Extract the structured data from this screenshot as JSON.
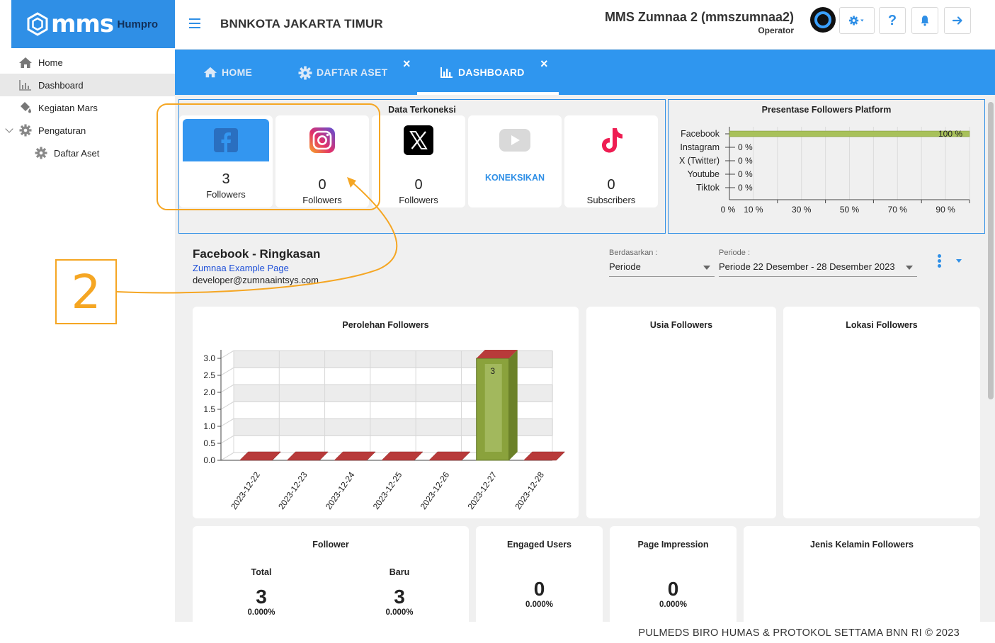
{
  "brand": {
    "logo_text": "mms",
    "app_name": "Humpro"
  },
  "header": {
    "org_title": "BNNKOTA JAKARTA TIMUR",
    "user_name": "MMS Zumnaa 2 (mmszumnaa2)",
    "user_role": "Operator",
    "help_label": "?"
  },
  "sidebar": {
    "items": [
      {
        "label": "Home",
        "icon": "home-icon"
      },
      {
        "label": "Dashboard",
        "icon": "chart-icon"
      },
      {
        "label": "Kegiatan Mars",
        "icon": "paint-bucket-icon"
      },
      {
        "label": "Pengaturan",
        "icon": "gear-icon"
      },
      {
        "label": "Daftar Aset",
        "icon": "gear-icon"
      }
    ],
    "active": "Dashboard"
  },
  "tabs": [
    {
      "label": "HOME",
      "icon": "home-icon",
      "closable": false
    },
    {
      "label": "DAFTAR ASET",
      "icon": "gear-icon",
      "closable": true
    },
    {
      "label": "DASHBOARD",
      "icon": "chart-icon",
      "closable": true,
      "active": true
    }
  ],
  "tab_close_glyph": "×",
  "connected": {
    "title": "Data Terkoneksi",
    "cards": [
      {
        "platform": "Facebook",
        "value": "3",
        "label": "Followers"
      },
      {
        "platform": "Instagram",
        "value": "0",
        "label": "Followers"
      },
      {
        "platform": "X",
        "value": "0",
        "label": "Followers"
      },
      {
        "platform": "Youtube",
        "action": "KONEKSIKAN"
      },
      {
        "platform": "Tiktok",
        "value": "0",
        "label": "Subscribers"
      }
    ]
  },
  "platform_percent": {
    "title": "Presentase Followers Platform",
    "rows": [
      {
        "name": "Facebook",
        "value": 100,
        "label": "100 %"
      },
      {
        "name": "Instagram",
        "value": 0,
        "label": "0 %"
      },
      {
        "name": "X (Twitter)",
        "value": 0,
        "label": "0 %"
      },
      {
        "name": "Youtube",
        "value": 0,
        "label": "0 %"
      },
      {
        "name": "Tiktok",
        "value": 0,
        "label": "0 %"
      }
    ],
    "ticks": [
      "0 %",
      "10 %",
      "30 %",
      "50 %",
      "70 %",
      "90 %"
    ],
    "tick_values": [
      0,
      10,
      30,
      50,
      70,
      90
    ],
    "bar_color": "#a8c15a"
  },
  "summary": {
    "title": "Facebook - Ringkasan",
    "page_link": "Zumnaa Example Page",
    "email": "developer@zumnaaintsys.com"
  },
  "filters": {
    "basis_label": "Berdasarkan :",
    "basis_value": "Periode",
    "period_label": "Periode :",
    "period_value": "Periode 22 Desember - 28 Desember 2023"
  },
  "widgets": {
    "gain_title": "Perolehan Followers",
    "age_title": "Usia Followers",
    "location_title": "Lokasi Followers",
    "follower_title": "Follower",
    "follower_total_label": "Total",
    "follower_total_value": "3",
    "follower_total_pct": "0.000%",
    "follower_new_label": "Baru",
    "follower_new_value": "3",
    "follower_new_pct": "0.000%",
    "engaged_title": "Engaged Users",
    "engaged_value": "0",
    "engaged_pct": "0.000%",
    "impression_title": "Page Impression",
    "impression_value": "0",
    "impression_pct": "0.000%",
    "gender_title": "Jenis Kelamin Followers"
  },
  "chart_data": {
    "type": "bar",
    "title": "Perolehan Followers",
    "categories": [
      "2023-12-22",
      "2023-12-23",
      "2023-12-24",
      "2023-12-25",
      "2023-12-26",
      "2023-12-27",
      "2023-12-28"
    ],
    "values": [
      0,
      0,
      0,
      0,
      0,
      3,
      0
    ],
    "data_labels": [
      "",
      "",
      "",
      "",
      "",
      "3",
      ""
    ],
    "ylim": [
      0,
      3
    ],
    "yticks": [
      "0.0",
      "0.5",
      "1.0",
      "1.5",
      "2.0",
      "2.5",
      "3.0"
    ],
    "ytick_values": [
      0,
      0.5,
      1,
      1.5,
      2,
      2.5,
      3
    ],
    "bar_color": "#8aa23c",
    "bar_top_color": "#b83a3a",
    "grid": true
  },
  "footer": {
    "text": "PULMEDS BIRO HUMAS & PROTOKOL SETTAMA BNN RI © 2023"
  },
  "annotation": {
    "number": "2",
    "color": "#f5a623"
  }
}
